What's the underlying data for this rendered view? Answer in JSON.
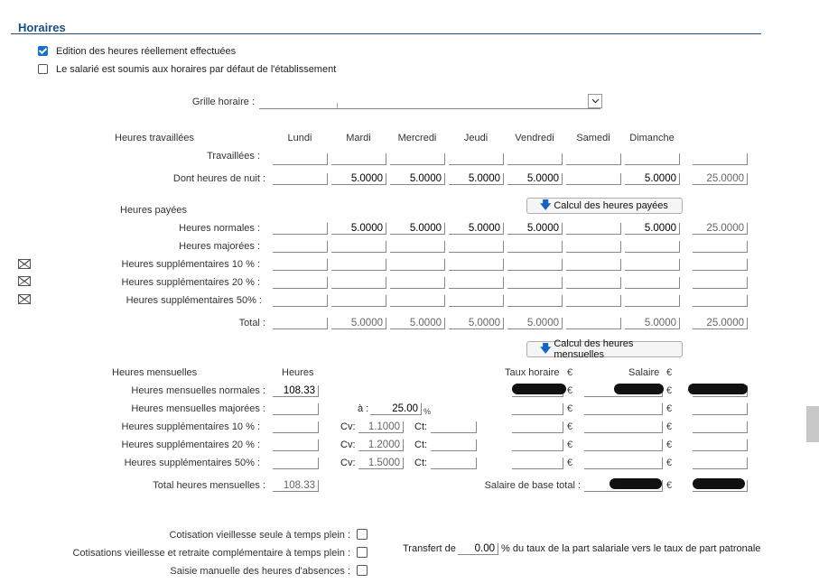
{
  "section": {
    "title": "Horaires"
  },
  "options": {
    "real_hours": {
      "label": "Edition des heures réellement effectuées",
      "checked": true
    },
    "default_hours": {
      "label": "Le salarié est soumis aux horaires par défaut de l'établissement",
      "checked": false
    }
  },
  "grille": {
    "label": "Grille horaire :",
    "value": ""
  },
  "worked": {
    "title": "Heures travaillées",
    "days": [
      "Lundi",
      "Mardi",
      "Mercredi",
      "Jeudi",
      "Vendredi",
      "Samedi",
      "Dimanche"
    ],
    "rows": [
      {
        "label": "Travaillées :",
        "values": [
          "",
          "",
          "",
          "",
          "",
          "",
          ""
        ],
        "total": ""
      },
      {
        "label": "Dont heures de nuit :",
        "values": [
          "",
          "5.0000",
          "5.0000",
          "5.0000",
          "5.0000",
          "",
          "5.0000"
        ],
        "total": "25.0000"
      }
    ],
    "calc_button": "Calcul des heures payées"
  },
  "paid": {
    "title": "Heures payées",
    "rows": [
      {
        "label": "Heures normales :",
        "values": [
          "",
          "5.0000",
          "5.0000",
          "5.0000",
          "5.0000",
          "",
          "5.0000"
        ],
        "total": "25.0000",
        "icon": false
      },
      {
        "label": "Heures majorées :",
        "values": [
          "",
          "",
          "",
          "",
          "",
          "",
          ""
        ],
        "total": "",
        "icon": false
      },
      {
        "label": "Heures supplémentaires 10 % :",
        "values": [
          "",
          "",
          "",
          "",
          "",
          "",
          ""
        ],
        "total": "",
        "icon": true
      },
      {
        "label": "Heures supplémentaires 20 % :",
        "values": [
          "",
          "",
          "",
          "",
          "",
          "",
          ""
        ],
        "total": "",
        "icon": true
      },
      {
        "label": "Heures supplémentaires 50% :",
        "values": [
          "",
          "",
          "",
          "",
          "",
          "",
          ""
        ],
        "total": "",
        "icon": true
      },
      {
        "label": "Total :",
        "values": [
          "",
          "5.0000",
          "5.0000",
          "5.0000",
          "5.0000",
          "",
          "5.0000"
        ],
        "total": "25.0000",
        "icon": false
      }
    ],
    "calc_button": "Calcul des heures mensuelles"
  },
  "monthly": {
    "title": "Heures mensuelles",
    "col_heures": "Heures",
    "col_taux": "Taux horaire",
    "col_salaire": "Salaire",
    "currency": "€",
    "pct": "%",
    "a_label": "à :",
    "a_value": "25.00",
    "cv_label": "Cv:",
    "ct_label": "Ct:",
    "rows": [
      {
        "label": "Heures mensuelles normales :",
        "heures": "108.33"
      },
      {
        "label": "Heures mensuelles majorées :",
        "heures": ""
      },
      {
        "label": "Heures supplémentaires 10 % :",
        "heures": "",
        "cv": "1.1000",
        "ct": ""
      },
      {
        "label": "Heures supplémentaires 20 % :",
        "heures": "",
        "cv": "1.2000",
        "ct": ""
      },
      {
        "label": "Heures supplémentaires 50% :",
        "heures": "",
        "cv": "1.5000",
        "ct": ""
      }
    ],
    "total_label": "Total heures mensuelles :",
    "total_value": "108.33",
    "salaire_base_label": "Salaire de base total :"
  },
  "bottom": {
    "cotisation_vieillesse": "Cotisation vieillesse seule à temps plein :",
    "cotisations_retraite": "Cotisations vieillesse et retraite complémentaire à temps plein :",
    "saisie_absences": "Saisie manuelle des heures d'absences :",
    "transfert_label": "Transfert de",
    "transfert_value": "0.00",
    "transfert_suffix": "% du taux de la part salariale vers le taux de part patronale"
  },
  "icons": {
    "combo": "chevron-down-icon",
    "calc": "arrow-down-icon",
    "row": "mail-icon"
  }
}
